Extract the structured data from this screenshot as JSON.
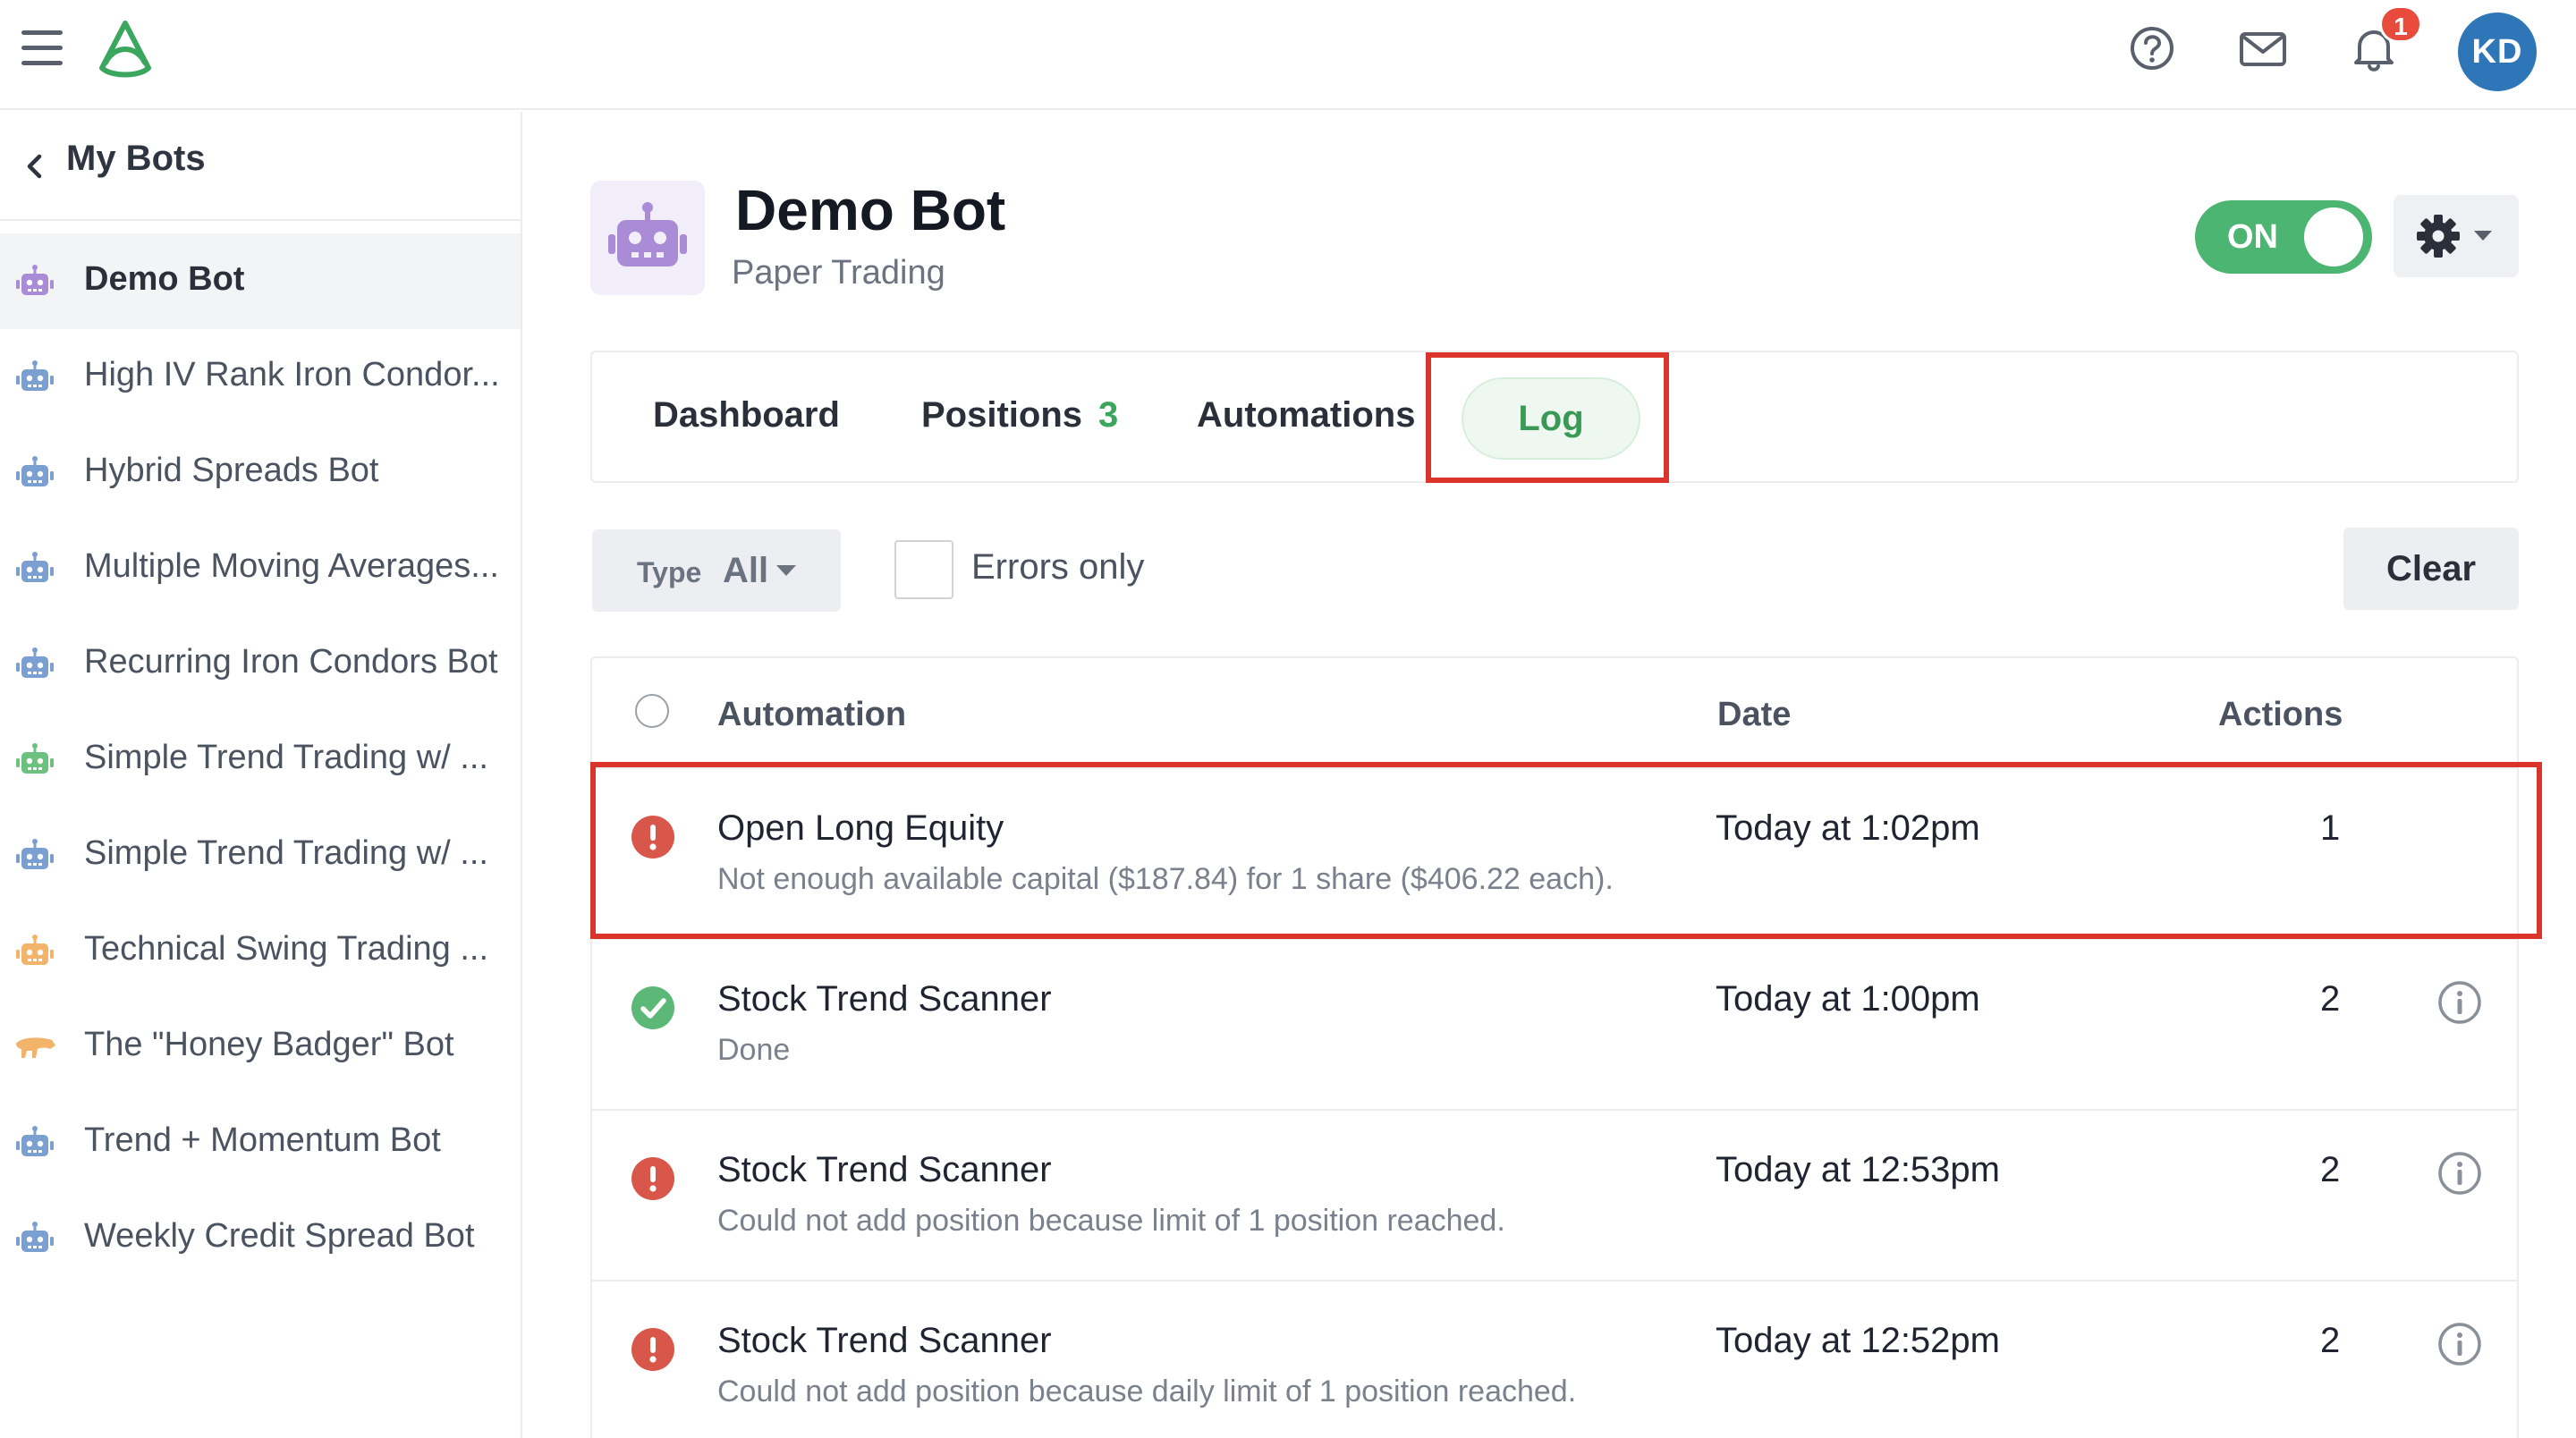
{
  "topbar": {
    "notification_count": "1",
    "avatar_initials": "KD"
  },
  "sidebar": {
    "back_label": "My Bots",
    "bots": [
      {
        "label": "Demo Bot",
        "color": "#a98bd6",
        "active": true
      },
      {
        "label": "High IV Rank Iron Condor...",
        "color": "#7a9fd0"
      },
      {
        "label": "Hybrid Spreads Bot",
        "color": "#7a9fd0"
      },
      {
        "label": "Multiple Moving Averages...",
        "color": "#7a9fd0"
      },
      {
        "label": "Recurring Iron Condors Bot",
        "color": "#7a9fd0"
      },
      {
        "label": "Simple Trend Trading w/ ...",
        "color": "#6cc17e"
      },
      {
        "label": "Simple Trend Trading w/ ...",
        "color": "#7a9fd0"
      },
      {
        "label": "Technical Swing Trading ...",
        "color": "#f2b36b"
      },
      {
        "label": "The \"Honey Badger\" Bot",
        "color": "#f2b36b"
      },
      {
        "label": "Trend + Momentum Bot",
        "color": "#7a9fd0"
      },
      {
        "label": "Weekly Credit Spread Bot",
        "color": "#7a9fd0"
      }
    ]
  },
  "header": {
    "title": "Demo Bot",
    "subtitle": "Paper Trading",
    "toggle_label": "ON"
  },
  "tabs": {
    "dashboard": "Dashboard",
    "positions": "Positions",
    "positions_count": "3",
    "automations": "Automations",
    "log": "Log"
  },
  "filters": {
    "type_label": "Type",
    "type_value": "All",
    "errors_only_label": "Errors only",
    "clear_label": "Clear"
  },
  "table": {
    "columns": {
      "automation": "Automation",
      "date": "Date",
      "actions": "Actions"
    },
    "rows": [
      {
        "status": "error",
        "title": "Open Long Equity",
        "detail": "Not enough available capital ($187.84) for 1 share ($406.22 each).",
        "date": "Today at 1:02pm",
        "actions": "1",
        "info": false
      },
      {
        "status": "success",
        "title": "Stock Trend Scanner",
        "detail": "Done",
        "date": "Today at 1:00pm",
        "actions": "2",
        "info": true
      },
      {
        "status": "error",
        "title": "Stock Trend Scanner",
        "detail": "Could not add position because limit of 1 position reached.",
        "date": "Today at 12:53pm",
        "actions": "2",
        "info": true
      },
      {
        "status": "error",
        "title": "Stock Trend Scanner",
        "detail": "Could not add position because daily limit of 1 position reached.",
        "date": "Today at 12:52pm",
        "actions": "2",
        "info": true
      }
    ]
  },
  "colors": {
    "accent_green": "#4cb572",
    "error_red": "#d9574a",
    "highlight_red": "#d9352b",
    "avatar_blue": "#2f76b8"
  }
}
